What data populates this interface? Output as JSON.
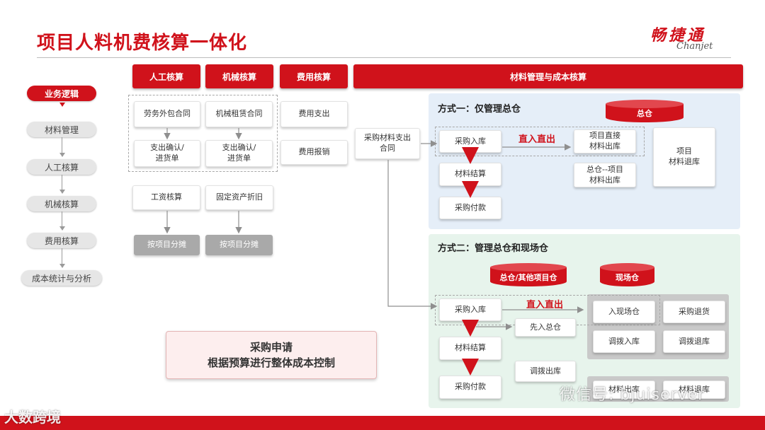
{
  "header": {
    "title": "项目人料机费核算一体化",
    "logo_cn": "畅捷通",
    "logo_en": "Chanjet"
  },
  "flow": {
    "items": [
      "业务逻辑",
      "材料管理",
      "人工核算",
      "机械核算",
      "费用核算",
      "成本统计与分析"
    ]
  },
  "columns": {
    "labor": "人工核算",
    "machine": "机械核算",
    "expense": "费用核算",
    "material": "材料管理与成本核算"
  },
  "boxes": {
    "labor_contract": "劳务外包合同",
    "labor_confirm": "支出确认/\n进货单",
    "machine_contract": "机械租赁合同",
    "machine_confirm": "支出确认/\n进货单",
    "expense_pay": "费用支出",
    "expense_reimb": "费用报销",
    "salary": "工资核算",
    "asset_dep": "固定资产折旧",
    "alloc1": "按项目分摊",
    "alloc2": "按项目分摊",
    "purchase_contract": "采购材料支出\n合同"
  },
  "mode1": {
    "title": "方式一：仅管理总仓",
    "warehouse": "总仓",
    "inbound": "采购入库",
    "direct": "直入直出",
    "out_direct": "项目直接\n材料出库",
    "settle": "材料结算",
    "pay": "采购付款",
    "out_central": "总仓--项目\n材料出库",
    "return": "项目\n材料退库"
  },
  "mode2": {
    "title": "方式二：管理总仓和现场仓",
    "warehouse_main": "总仓/其他项目仓",
    "warehouse_site": "现场仓",
    "inbound": "采购入库",
    "direct": "直入直出",
    "first_central": "先入总仓",
    "settle": "材料结算",
    "transfer_out": "调拨出库",
    "pay": "采购付款",
    "site_in": "入现场仓",
    "purchase_return": "采购退货",
    "transfer_in": "调拨入库",
    "transfer_return": "调拨退库",
    "out_partial": "材料出库",
    "return_partial": "材料退库"
  },
  "budget": {
    "line1": "采购申请",
    "line2": "根据预算进行整体成本控制"
  },
  "watermarks": {
    "wechat": "微信号: bjuiserver",
    "brand": "大数跨境"
  }
}
